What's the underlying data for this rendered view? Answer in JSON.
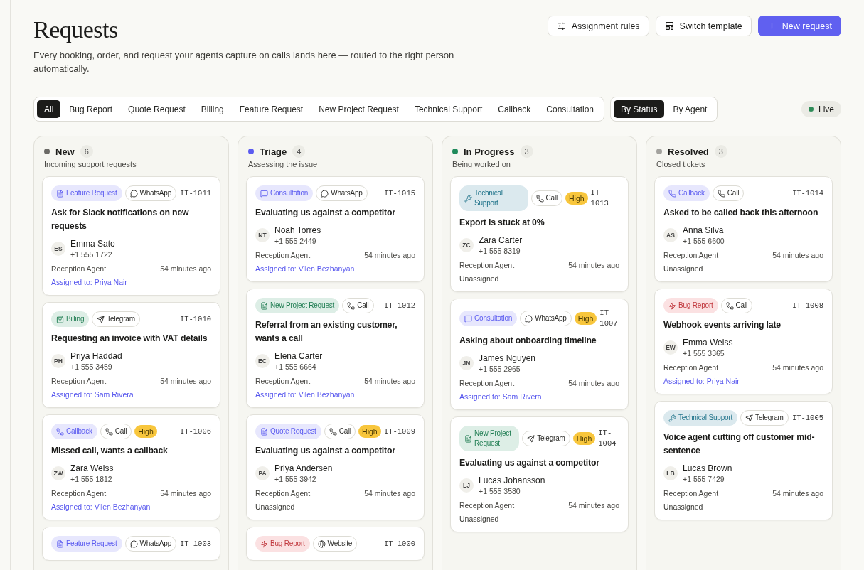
{
  "header": {
    "title": "Requests",
    "subtitle": "Every booking, order, and request your agents capture on calls lands here — routed to the right person automatically.",
    "actions": [
      {
        "label": "Assignment rules",
        "kind": "rules"
      },
      {
        "label": "Switch template",
        "kind": "template"
      },
      {
        "label": "New request",
        "kind": "new"
      }
    ]
  },
  "filters": [
    {
      "label": "All",
      "selected": true
    },
    {
      "label": "Bug Report",
      "selected": false
    },
    {
      "label": "Quote Request",
      "selected": false
    },
    {
      "label": "Billing",
      "selected": false
    },
    {
      "label": "Feature Request",
      "selected": false
    },
    {
      "label": "New Project Request",
      "selected": false
    },
    {
      "label": "Technical Support",
      "selected": false
    },
    {
      "label": "Callback",
      "selected": false
    },
    {
      "label": "Consultation",
      "selected": false
    }
  ],
  "views": [
    {
      "label": "By Status",
      "selected": true
    },
    {
      "label": "By Agent",
      "selected": false
    }
  ],
  "live": {
    "label": "Live",
    "color": "#2e8b57"
  },
  "columns": [
    {
      "title": "New",
      "count": "6",
      "color": "#6b6a66",
      "description": "Incoming support requests",
      "cards": [
        {
          "category": {
            "label": "Feature Request",
            "kind": "feature"
          },
          "channel": {
            "label": "WhatsApp",
            "kind": "whatsapp"
          },
          "id": "IT-1011",
          "title": "Ask for Slack notifications on new requests",
          "initials": "ES",
          "name": "Emma Sato",
          "phone": "+1 555 1722",
          "agent": "Reception Agent",
          "time": "54 minutes ago",
          "assignment": {
            "text": "Assigned to: Priya Nair",
            "assigned": true
          }
        },
        {
          "category": {
            "label": "Billing",
            "kind": "billing"
          },
          "channel": {
            "label": "Telegram",
            "kind": "telegram"
          },
          "id": "IT-1010",
          "title": "Requesting an invoice with VAT details",
          "initials": "PH",
          "name": "Priya Haddad",
          "phone": "+1 555 3459",
          "agent": "Reception Agent",
          "time": "54 minutes ago",
          "assignment": {
            "text": "Assigned to: Sam Rivera",
            "assigned": true
          }
        },
        {
          "category": {
            "label": "Callback",
            "kind": "callback"
          },
          "channel": {
            "label": "Call",
            "kind": "call"
          },
          "priority": "High",
          "id": "IT-1006",
          "title": "Missed call, wants a callback",
          "initials": "ZW",
          "name": "Zara Weiss",
          "phone": "+1 555 1812",
          "agent": "Reception Agent",
          "time": "54 minutes ago",
          "assignment": {
            "text": "Assigned to: Vilen Bezhanyan",
            "assigned": true
          }
        },
        {
          "category": {
            "label": "Feature Request",
            "kind": "feature"
          },
          "channel": {
            "label": "WhatsApp",
            "kind": "whatsapp"
          },
          "id": "IT-1003"
        }
      ]
    },
    {
      "title": "Triage",
      "count": "4",
      "color": "#5b5bf0",
      "description": "Assessing the issue",
      "cards": [
        {
          "category": {
            "label": "Consultation",
            "kind": "consultation"
          },
          "channel": {
            "label": "WhatsApp",
            "kind": "whatsapp"
          },
          "id": "IT-1015",
          "title": "Evaluating us against a competitor",
          "initials": "NT",
          "name": "Noah Torres",
          "phone": "+1 555 2449",
          "agent": "Reception Agent",
          "time": "54 minutes ago",
          "assignment": {
            "text": "Assigned to: Vilen Bezhanyan",
            "assigned": true
          }
        },
        {
          "category": {
            "label": "New Project Request",
            "kind": "project"
          },
          "channel": {
            "label": "Call",
            "kind": "call"
          },
          "id": "IT-1012",
          "title": "Referral from an existing customer, wants a call",
          "initials": "EC",
          "name": "Elena Carter",
          "phone": "+1 555 6664",
          "agent": "Reception Agent",
          "time": "54 minutes ago",
          "assignment": {
            "text": "Assigned to: Vilen Bezhanyan",
            "assigned": true
          }
        },
        {
          "category": {
            "label": "Quote Request",
            "kind": "quote"
          },
          "channel": {
            "label": "Call",
            "kind": "call"
          },
          "priority": "High",
          "id": "IT-1009",
          "title": "Evaluating us against a competitor",
          "initials": "PA",
          "name": "Priya Andersen",
          "phone": "+1 555 3942",
          "agent": "Reception Agent",
          "time": "54 minutes ago",
          "assignment": {
            "text": "Unassigned",
            "assigned": false
          }
        },
        {
          "category": {
            "label": "Bug Report",
            "kind": "bug"
          },
          "channel": {
            "label": "Website",
            "kind": "website"
          },
          "id": "IT-1000"
        }
      ]
    },
    {
      "title": "In Progress",
      "count": "3",
      "color": "#1f8a5b",
      "description": "Being worked on",
      "cards": [
        {
          "category": {
            "label": "Technical Support",
            "kind": "tech"
          },
          "channel": {
            "label": "Call",
            "kind": "call"
          },
          "priority": "High",
          "id": "IT-1013",
          "title": "Export is stuck at 0%",
          "initials": "ZC",
          "name": "Zara Carter",
          "phone": "+1 555 8319",
          "agent": "Reception Agent",
          "time": "54 minutes ago",
          "assignment": {
            "text": "Unassigned",
            "assigned": false
          }
        },
        {
          "category": {
            "label": "Consultation",
            "kind": "consultation"
          },
          "channel": {
            "label": "WhatsApp",
            "kind": "whatsapp"
          },
          "priority": "High",
          "id": "IT-1007",
          "title": "Asking about onboarding timeline",
          "initials": "JN",
          "name": "James Nguyen",
          "phone": "+1 555 2965",
          "agent": "Reception Agent",
          "time": "54 minutes ago",
          "assignment": {
            "text": "Assigned to: Sam Rivera",
            "assigned": true
          }
        },
        {
          "category": {
            "label": "New Project Request",
            "kind": "project"
          },
          "channel": {
            "label": "Telegram",
            "kind": "telegram"
          },
          "priority": "High",
          "id": "IT-1004",
          "title": "Evaluating us against a competitor",
          "initials": "LJ",
          "name": "Lucas Johansson",
          "phone": "+1 555 3580",
          "agent": "Reception Agent",
          "time": "54 minutes ago",
          "assignment": {
            "text": "Unassigned",
            "assigned": false
          }
        }
      ]
    },
    {
      "title": "Resolved",
      "count": "3",
      "color": "#a3a29e",
      "description": "Closed tickets",
      "cards": [
        {
          "category": {
            "label": "Callback",
            "kind": "callback"
          },
          "channel": {
            "label": "Call",
            "kind": "call"
          },
          "id": "IT-1014",
          "title": "Asked to be called back this afternoon",
          "initials": "AS",
          "name": "Anna Silva",
          "phone": "+1 555 6600",
          "agent": "Reception Agent",
          "time": "54 minutes ago",
          "assignment": {
            "text": "Unassigned",
            "assigned": false
          }
        },
        {
          "category": {
            "label": "Bug Report",
            "kind": "bug"
          },
          "channel": {
            "label": "Call",
            "kind": "call"
          },
          "id": "IT-1008",
          "title": "Webhook events arriving late",
          "initials": "EW",
          "name": "Emma Weiss",
          "phone": "+1 555 3365",
          "agent": "Reception Agent",
          "time": "54 minutes ago",
          "assignment": {
            "text": "Assigned to: Priya Nair",
            "assigned": true
          }
        },
        {
          "category": {
            "label": "Technical Support",
            "kind": "tech"
          },
          "channel": {
            "label": "Telegram",
            "kind": "telegram"
          },
          "id": "IT-1005",
          "title": "Voice agent cutting off customer mid-sentence",
          "initials": "LB",
          "name": "Lucas Brown",
          "phone": "+1 555 7429",
          "agent": "Reception Agent",
          "time": "54 minutes ago",
          "assignment": {
            "text": "Unassigned",
            "assigned": false
          }
        }
      ]
    }
  ]
}
